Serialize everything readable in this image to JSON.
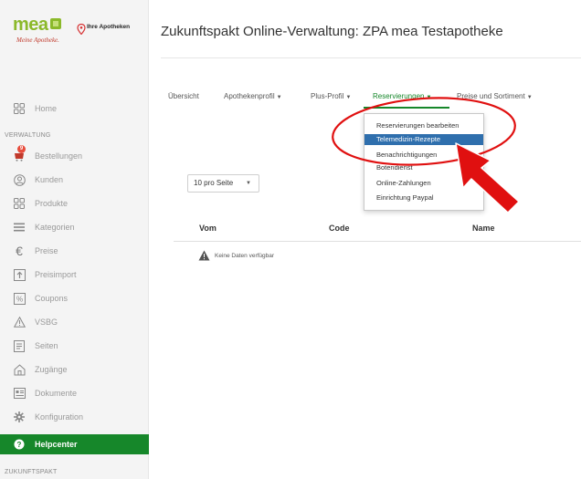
{
  "logo": {
    "brand": "mea",
    "script": "Meine Apotheke.",
    "ihre": "Ihre Apotheken"
  },
  "sidebar": {
    "home": {
      "label": "Home",
      "icon": "grid-icon"
    },
    "section_verwaltung": "VERWALTUNG",
    "items": [
      {
        "label": "Bestellungen",
        "icon": "cart-icon",
        "badge": "9"
      },
      {
        "label": "Kunden",
        "icon": "user-circle-icon"
      },
      {
        "label": "Produkte",
        "icon": "grid-icon"
      },
      {
        "label": "Kategorien",
        "icon": "list-icon"
      },
      {
        "label": "Preise",
        "icon": "euro-icon"
      },
      {
        "label": "Preisimport",
        "icon": "upload-icon"
      },
      {
        "label": "Coupons",
        "icon": "percent-icon"
      },
      {
        "label": "VSBG",
        "icon": "warning-icon"
      },
      {
        "label": "Seiten",
        "icon": "page-icon"
      },
      {
        "label": "Zugänge",
        "icon": "home-icon"
      },
      {
        "label": "Dokumente",
        "icon": "document-icon"
      },
      {
        "label": "Konfiguration",
        "icon": "gear-icon"
      }
    ],
    "helpcenter": {
      "label": "Helpcenter",
      "icon": "help-circle-icon"
    },
    "section_zukunftspakt": "ZUKUNFTSPAKT"
  },
  "header": {
    "title": "Zukunftspakt Online-Verwaltung: ZPA mea Testapotheke"
  },
  "tabs": [
    {
      "label": "Übersicht",
      "caret": ""
    },
    {
      "label": "Apothekenprofil",
      "caret": "▼"
    },
    {
      "label": "Plus-Profil",
      "caret": "▼"
    },
    {
      "label": "Reservierungen",
      "caret": "▼"
    },
    {
      "label": "Preise und Sortiment",
      "caret": "▼"
    }
  ],
  "dropdown": {
    "items": [
      "Reservierungen bearbeiten",
      "Telemedizin-Rezepte",
      "Benachrichtigungen",
      "Botendienst",
      "Online-Zahlungen",
      "Einrichtung Paypal"
    ],
    "selected_index": 1
  },
  "table": {
    "per_page": "10 pro Seite",
    "per_page_caret": "▼",
    "columns": [
      "Vom",
      "Code",
      "Name"
    ],
    "empty_message": "Keine Daten verfügbar"
  },
  "colors": {
    "brand_green": "#16872a",
    "logo_green": "#8bb92a",
    "selected_blue": "#2f6fad",
    "annotation_red": "#e01010"
  }
}
